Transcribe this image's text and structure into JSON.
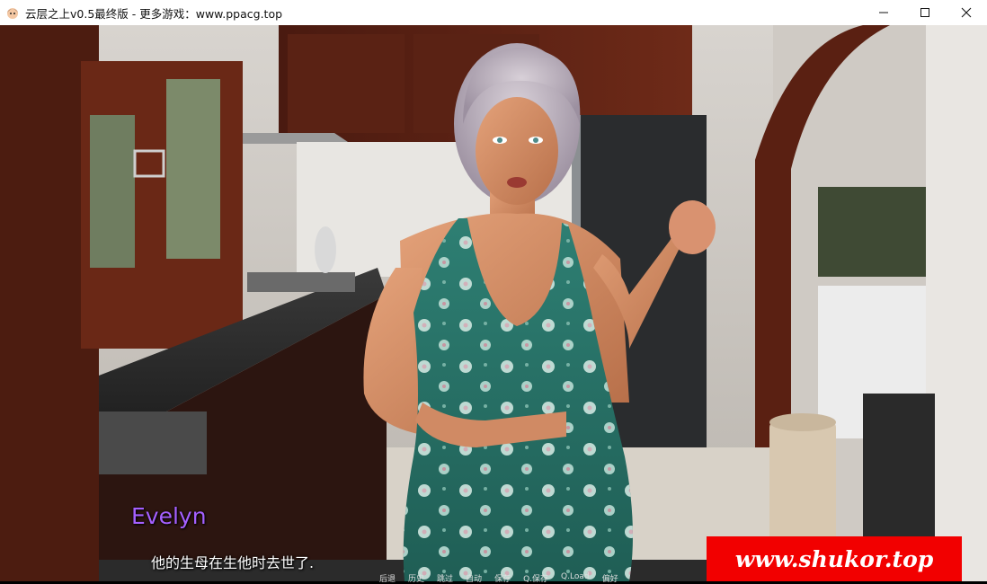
{
  "window": {
    "title": "云层之上v0.5最终版 - 更多游戏：www.ppacg.top",
    "icon": "app-icon",
    "controls": [
      "minimize-icon",
      "maximize-icon",
      "close-icon"
    ]
  },
  "dialogue": {
    "speaker": "Evelyn",
    "speaker_color": "#a560ff",
    "text": "他的生母在生他时去世了."
  },
  "quick_menu": {
    "items": [
      "后退",
      "历史",
      "跳过",
      "自动",
      "保存",
      "Q.保存",
      "Q.Load",
      "偏好"
    ]
  },
  "watermark": {
    "text": "www.shukor.top",
    "background": "#f20000"
  }
}
